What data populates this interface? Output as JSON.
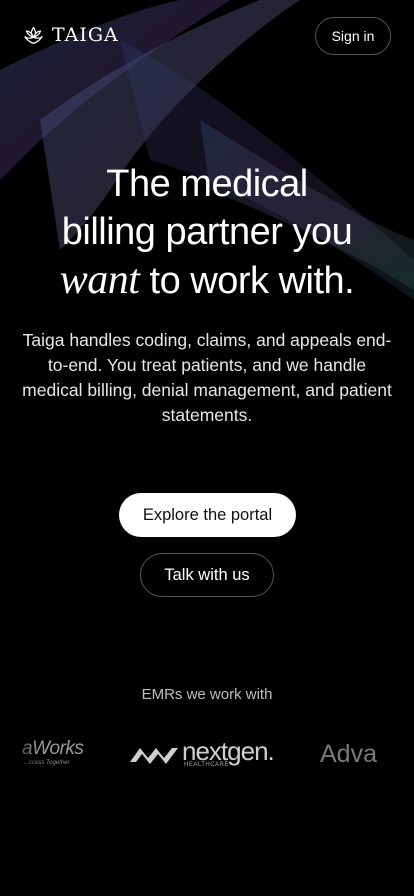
{
  "header": {
    "brand": "TAIGA",
    "logo_icon": "lotus-logo-icon",
    "signin_label": "Sign in"
  },
  "hero": {
    "line1": "The medical",
    "line2": "billing partner you",
    "line3_emphasis": "want",
    "line3_rest": " to work with."
  },
  "description": "Taiga handles coding, claims, and appeals end-to-end. You treat patients, and we handle medical billing, denial management, and patient statements.",
  "actions": {
    "primary_label": "Explore the portal",
    "secondary_label": "Talk with us"
  },
  "emr": {
    "heading": "EMRs we work with",
    "logos": [
      {
        "name": "aWorks",
        "tagline": "...ccess Together"
      },
      {
        "name": "nextgen.",
        "tagline": "HEALTHCARE"
      },
      {
        "name": "Adva"
      }
    ]
  },
  "colors": {
    "background": "#000000",
    "text": "#ffffff",
    "button_primary_bg": "#ffffff"
  }
}
